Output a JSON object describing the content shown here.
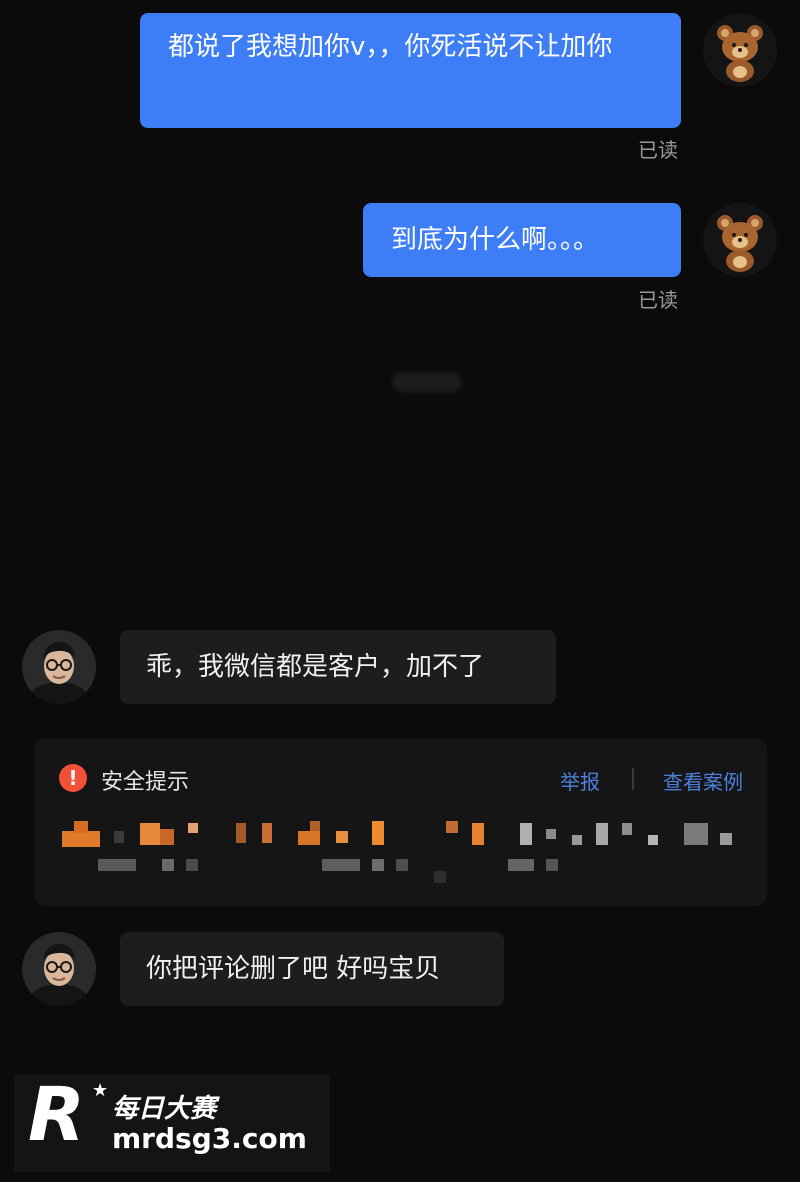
{
  "messages": {
    "sent_1": "都说了我想加你v，，你死活说不让加你",
    "sent_1_status": "已读",
    "sent_2": "到底为什么啊。。。",
    "sent_2_status": "已读",
    "received_1": "乖，我微信都是客户，加不了",
    "received_2": "你把评论删了吧 好吗宝贝"
  },
  "safety_tip": {
    "icon": "exclamation-warning-icon",
    "title": "安全提示",
    "report_link": "举报",
    "cases_link": "查看案例"
  },
  "watermark": {
    "logo_letter": "R",
    "brand": "每日大赛",
    "url": "mrdsg3.com"
  },
  "colors": {
    "background": "#0b0b0b",
    "self_bubble": "#3d7df6",
    "other_bubble": "#1d1d1f",
    "link": "#4d7fdc",
    "warning": "#f25037"
  }
}
